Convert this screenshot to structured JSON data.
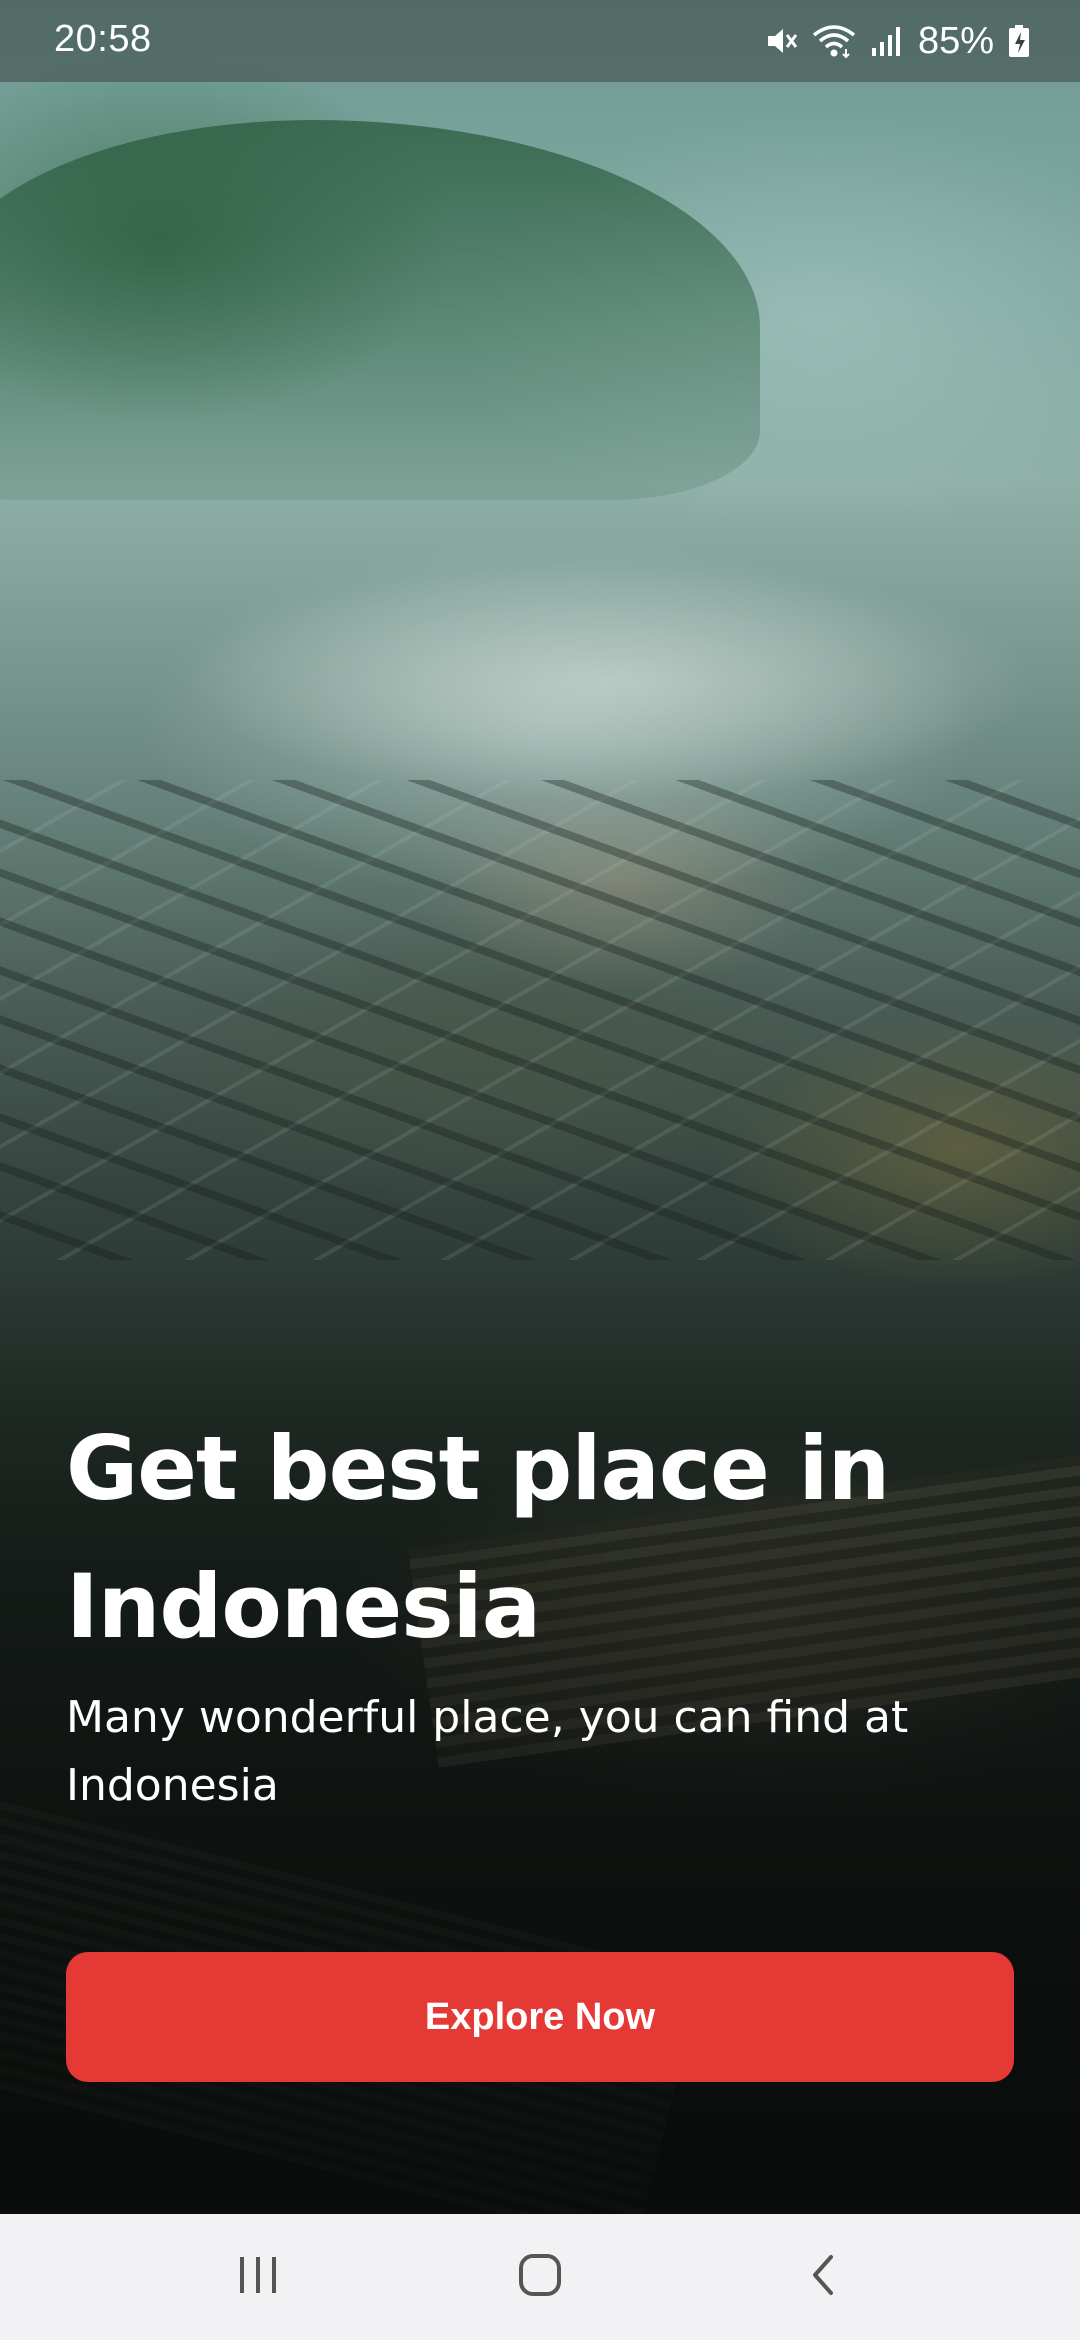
{
  "status_bar": {
    "time": "20:58",
    "battery_percent": "85%",
    "icons": [
      "mute-icon",
      "wifi-icon",
      "signal-icon",
      "battery-charging-icon"
    ]
  },
  "hero": {
    "title": "Get best place in Indonesia",
    "subtitle": "Many wonderful place, you can find at Indonesia",
    "background_image": "misty-village-landscape"
  },
  "cta": {
    "label": "Explore Now",
    "color": "#e53935"
  },
  "nav_bar": {
    "buttons": [
      "recent-apps-icon",
      "home-icon",
      "back-icon"
    ]
  }
}
